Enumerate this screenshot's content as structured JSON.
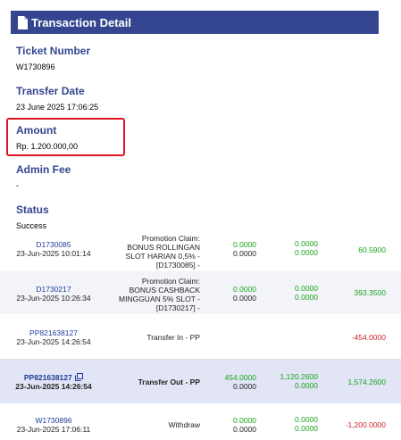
{
  "header": {
    "title": "Transaction Detail",
    "icon": "document-icon",
    "color": "#34468f"
  },
  "fields": {
    "ticket": {
      "label": "Ticket Number",
      "value": "W1730896"
    },
    "transfer_date": {
      "label": "Transfer Date",
      "value": "23 June 2025 17:06:25"
    },
    "amount": {
      "label": "Amount",
      "value": "Rp. 1.200.000,00"
    },
    "admin_fee": {
      "label": "Admin Fee",
      "value": "-"
    },
    "status": {
      "label": "Status",
      "value": "Success"
    }
  },
  "highlight_color": "#e0141e",
  "rows": [
    {
      "id": "D1730085",
      "date": "23-Jun-2025 10:01:14",
      "desc": [
        "Promotion Claim:",
        "BONUS ROLLINGAN",
        "SLOT HARIAN 0,5% -",
        "[D1730085] -"
      ],
      "c1": [
        "0.0000",
        "0.0000"
      ],
      "c2": [
        "0.0000",
        "0.0000"
      ],
      "c3": "60.5900"
    },
    {
      "id": "D1730217",
      "date": "23-Jun-2025 10:26:34",
      "desc": [
        "Promotion Claim:",
        "BONUS CASHBACK",
        "MINGGUAN 5% SLOT -",
        "[D1730217] -"
      ],
      "c1": [
        "0.0000",
        "0.0000"
      ],
      "c2": [
        "0.0000",
        "0.0000"
      ],
      "c3": "393.3500"
    },
    {
      "id": "PP821638127",
      "date": "23-Jun-2025 14:26:54",
      "desc": [
        "Transfer In - PP"
      ],
      "c3": "-454.0000"
    },
    {
      "id": "PP821638127",
      "date": "23-Jun-2025 14:26:54",
      "desc": [
        "Transfer Out - PP"
      ],
      "c1": [
        "454.0000",
        "0.0000"
      ],
      "c2": [
        "1,120.2600",
        "0.0000"
      ],
      "c3": "1,574.2600"
    },
    {
      "id": "W1730896",
      "date": "23-Jun-2025 17:06:11",
      "desc": [
        "Withdraw"
      ],
      "c1": [
        "0.0000",
        "0.0000"
      ],
      "c2": [
        "0.0000",
        "0.0000"
      ],
      "c3": "-1,200.0000"
    }
  ]
}
